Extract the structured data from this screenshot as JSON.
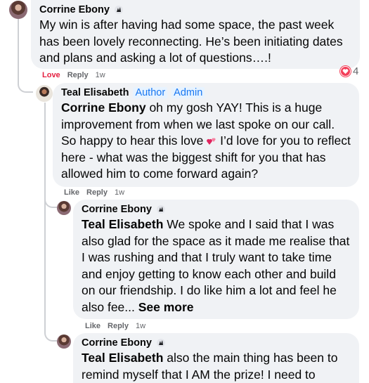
{
  "comments": [
    {
      "author": "Corrine Ebony",
      "text": "My win is after having had some space, the past week has been lovely reconnecting. He’s been initiating dates and plans and asking a lot of questions….!",
      "actions": {
        "love": "Love",
        "reply": "Reply",
        "time": "1w"
      },
      "reaction_count": "4"
    },
    {
      "author": "Teal Elisabeth",
      "tag_author": "Author",
      "tag_admin": "Admin",
      "mention": "Corrine Ebony",
      "text_part1": " oh my gosh YAY! This is a huge improvement from when we last spoke on our call. So happy to hear this love ",
      "text_part2": " I’d love for you to reflect here - what was the biggest shift for you that has allowed him to come forward again?",
      "actions": {
        "like": "Like",
        "reply": "Reply",
        "time": "1w"
      }
    },
    {
      "author": "Corrine Ebony",
      "mention": "Teal Elisabeth",
      "text": " We spoke and I said that I was also glad for the space as it made me realise that I was rushing and that I truly want to take time and enjoy getting to know each other and build on our friendship. I do like him a lot and feel he also fee... ",
      "see_more": "See more",
      "actions": {
        "like": "Like",
        "reply": "Reply",
        "time": "1w"
      }
    },
    {
      "author": "Corrine Ebony",
      "mention": "Teal Elisabeth",
      "text": " also the main thing has been to remind myself that I AM the prize! I need to"
    }
  ]
}
